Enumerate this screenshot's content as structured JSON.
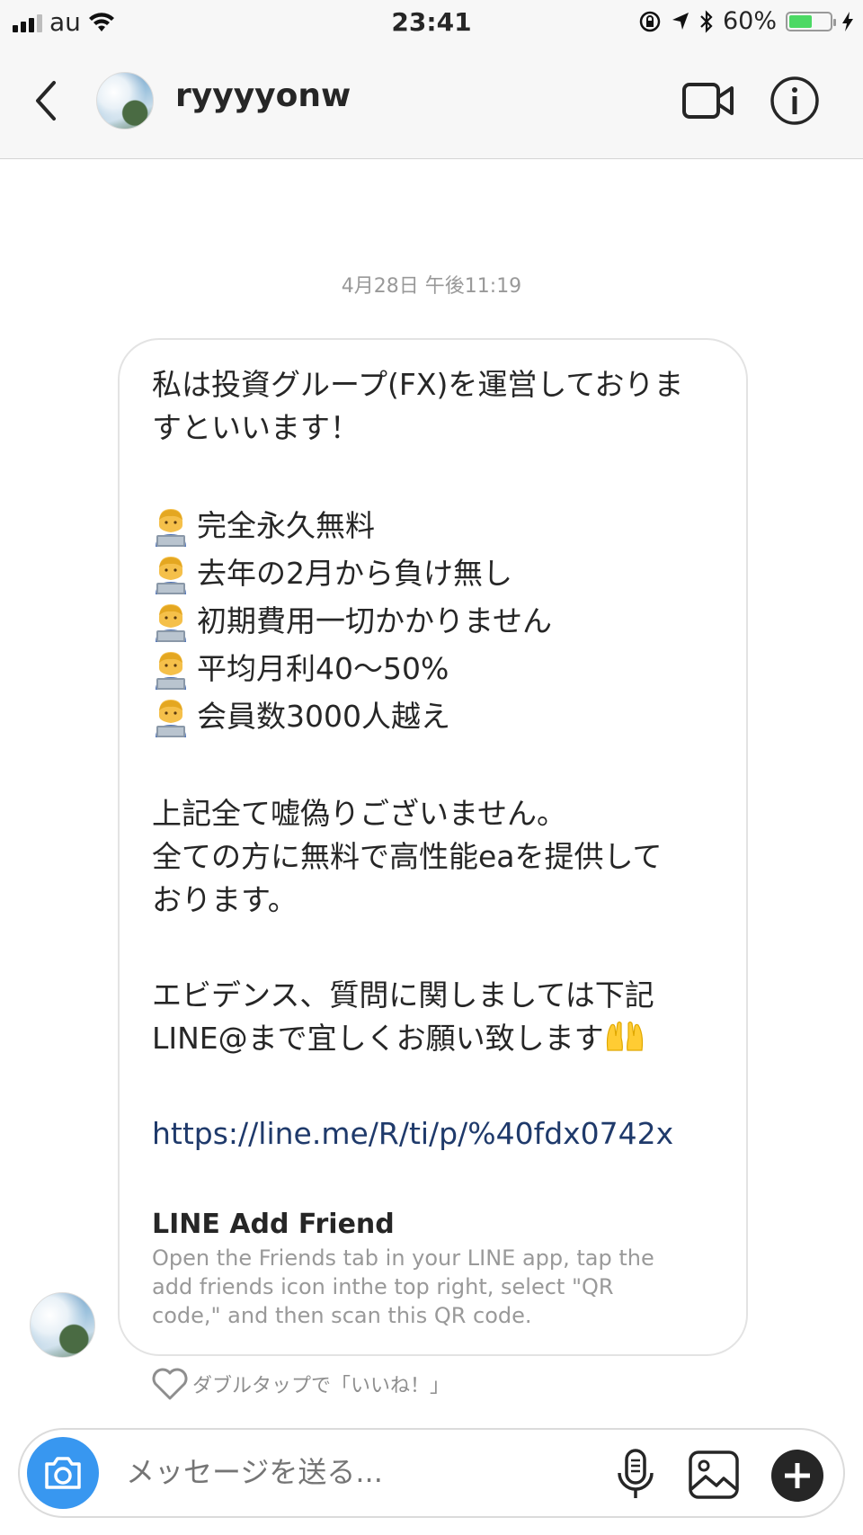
{
  "status_bar": {
    "carrier": "au",
    "time": "23:41",
    "battery_percent": "60%",
    "battery_level": 0.6,
    "battery_color": "#4cd964"
  },
  "header": {
    "username": "ryyyyonw",
    "back_icon": "chevron-left-icon",
    "video_icon": "video-camera-icon",
    "info_icon": "info-icon"
  },
  "conversation": {
    "timestamp": "4月28日 午後11:19",
    "message": {
      "intro_line1": "私は投資グループ(FX)を運営しておりま",
      "intro_line2": "すといいます！",
      "bullets": [
        "完全永久無料",
        "去年の2月から負け無し",
        "初期費用一切かかりません",
        "平均月利40〜50%",
        "会員数3000人越え"
      ],
      "para2_line1": "上記全て嘘偽りございません。",
      "para2_line2": "全ての方に無料で高性能eaを提供して",
      "para2_line3": "おります。",
      "para3_line1": "エビデンス、質問に関しましては下記",
      "para3_line2": "LINE@まで宜しくお願い致します",
      "link": "https://line.me/R/ti/p/%40fdx0742x",
      "card_title": "LINE Add Friend",
      "card_desc_line1": "Open the Friends tab in your LINE app, tap the",
      "card_desc_line2": "add friends icon inthe top right, select \"QR",
      "card_desc_line3": "code,\" and then scan this QR code."
    },
    "like_hint": "ダブルタップで「いいね！」"
  },
  "composer": {
    "placeholder": "メッセージを送る...",
    "accent_color": "#3897f0"
  }
}
